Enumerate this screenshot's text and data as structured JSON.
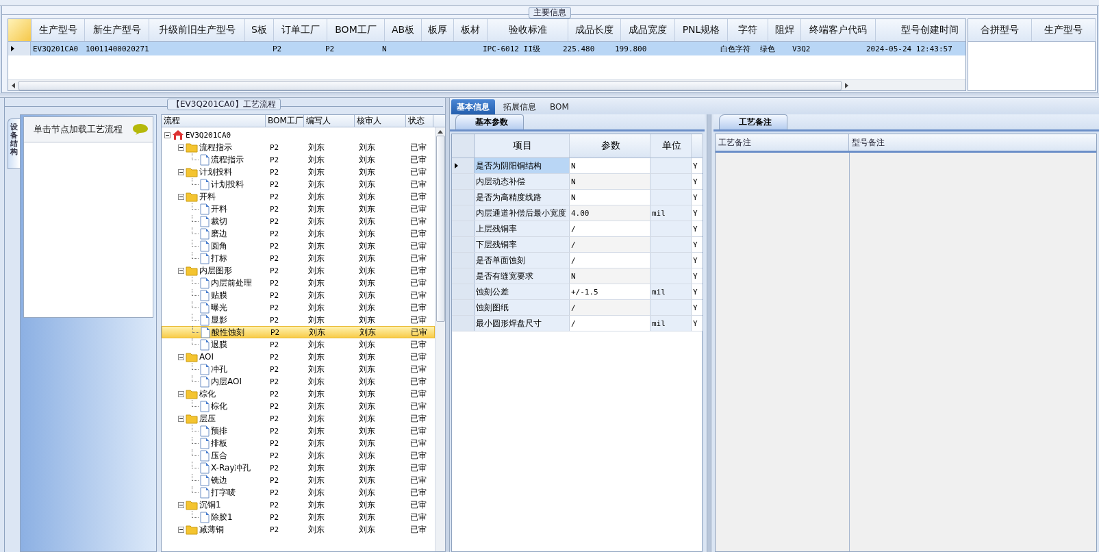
{
  "main_info": {
    "title": "主要信息",
    "columns": [
      "生产型号",
      "新生产型号",
      "升级前旧生产型号",
      "S板",
      "订单工厂",
      "BOM工厂",
      "AB板",
      "板厚",
      "板材",
      "验收标准",
      "成品长度",
      "成品宽度",
      "PNL规格",
      "字符",
      "阻焊",
      "终端客户代码",
      "型号创建时间"
    ],
    "rows": [
      {
        "selected": true,
        "cells": [
          "EV3Q201CA0",
          "10011400020271",
          "",
          "",
          "P2",
          "P2",
          "N",
          "",
          "",
          "IPC-6012 II级",
          "225.480",
          "199.800",
          "",
          "白色字符",
          "绿色",
          "V3Q2",
          "2024-05-24 12:43:57"
        ]
      }
    ],
    "side_columns": [
      "合拼型号",
      "生产型号"
    ]
  },
  "process": {
    "title": "【EV3Q201CA0】工艺流程",
    "side_tab": "设备结构",
    "hint": "单击节点加载工艺流程",
    "columns": [
      "流程",
      "BOM工厂",
      "编写人",
      "核审人",
      "状态"
    ],
    "tree": [
      {
        "kind": "root",
        "name": "EV3Q201CA0",
        "expanded": true,
        "selected": false,
        "children": [
          {
            "kind": "folder",
            "name": "流程指示",
            "bom": "P2",
            "writer": "刘东",
            "reviewer": "刘东",
            "status": "已审",
            "expanded": true,
            "selected": false,
            "children": [
              {
                "kind": "file",
                "name": "流程指示",
                "bom": "P2",
                "writer": "刘东",
                "reviewer": "刘东",
                "status": "已审",
                "selected": false
              }
            ]
          },
          {
            "kind": "folder",
            "name": "计划投料",
            "bom": "P2",
            "writer": "刘东",
            "reviewer": "刘东",
            "status": "已审",
            "expanded": true,
            "selected": false,
            "children": [
              {
                "kind": "file",
                "name": "计划投料",
                "bom": "P2",
                "writer": "刘东",
                "reviewer": "刘东",
                "status": "已审",
                "selected": false
              }
            ]
          },
          {
            "kind": "folder",
            "name": "开料",
            "bom": "P2",
            "writer": "刘东",
            "reviewer": "刘东",
            "status": "已审",
            "expanded": true,
            "selected": false,
            "children": [
              {
                "kind": "file",
                "name": "开料",
                "bom": "P2",
                "writer": "刘东",
                "reviewer": "刘东",
                "status": "已审",
                "selected": false
              },
              {
                "kind": "file",
                "name": "裁切",
                "bom": "P2",
                "writer": "刘东",
                "reviewer": "刘东",
                "status": "已审",
                "selected": false
              },
              {
                "kind": "file",
                "name": "磨边",
                "bom": "P2",
                "writer": "刘东",
                "reviewer": "刘东",
                "status": "已审",
                "selected": false
              },
              {
                "kind": "file",
                "name": "圆角",
                "bom": "P2",
                "writer": "刘东",
                "reviewer": "刘东",
                "status": "已审",
                "selected": false
              },
              {
                "kind": "file",
                "name": "打标",
                "bom": "P2",
                "writer": "刘东",
                "reviewer": "刘东",
                "status": "已审",
                "selected": false
              }
            ]
          },
          {
            "kind": "folder",
            "name": "内层图形",
            "bom": "P2",
            "writer": "刘东",
            "reviewer": "刘东",
            "status": "已审",
            "expanded": true,
            "selected": false,
            "children": [
              {
                "kind": "file",
                "name": "内层前处理",
                "bom": "P2",
                "writer": "刘东",
                "reviewer": "刘东",
                "status": "已审",
                "selected": false
              },
              {
                "kind": "file",
                "name": "贴膜",
                "bom": "P2",
                "writer": "刘东",
                "reviewer": "刘东",
                "status": "已审",
                "selected": false
              },
              {
                "kind": "file",
                "name": "曝光",
                "bom": "P2",
                "writer": "刘东",
                "reviewer": "刘东",
                "status": "已审",
                "selected": false
              },
              {
                "kind": "file",
                "name": "显影",
                "bom": "P2",
                "writer": "刘东",
                "reviewer": "刘东",
                "status": "已审",
                "selected": false
              },
              {
                "kind": "file",
                "name": "酸性蚀刻",
                "bom": "P2",
                "writer": "刘东",
                "reviewer": "刘东",
                "status": "已审",
                "selected": true
              },
              {
                "kind": "file",
                "name": "退膜",
                "bom": "P2",
                "writer": "刘东",
                "reviewer": "刘东",
                "status": "已审",
                "selected": false
              }
            ]
          },
          {
            "kind": "folder",
            "name": "AOI",
            "bom": "P2",
            "writer": "刘东",
            "reviewer": "刘东",
            "status": "已审",
            "expanded": true,
            "selected": false,
            "children": [
              {
                "kind": "file",
                "name": "冲孔",
                "bom": "P2",
                "writer": "刘东",
                "reviewer": "刘东",
                "status": "已审",
                "selected": false
              },
              {
                "kind": "file",
                "name": "内层AOI",
                "bom": "P2",
                "writer": "刘东",
                "reviewer": "刘东",
                "status": "已审",
                "selected": false
              }
            ]
          },
          {
            "kind": "folder",
            "name": "棕化",
            "bom": "P2",
            "writer": "刘东",
            "reviewer": "刘东",
            "status": "已审",
            "expanded": true,
            "selected": false,
            "children": [
              {
                "kind": "file",
                "name": "棕化",
                "bom": "P2",
                "writer": "刘东",
                "reviewer": "刘东",
                "status": "已审",
                "selected": false
              }
            ]
          },
          {
            "kind": "folder",
            "name": "层压",
            "bom": "P2",
            "writer": "刘东",
            "reviewer": "刘东",
            "status": "已审",
            "expanded": true,
            "selected": false,
            "children": [
              {
                "kind": "file",
                "name": "预排",
                "bom": "P2",
                "writer": "刘东",
                "reviewer": "刘东",
                "status": "已审",
                "selected": false
              },
              {
                "kind": "file",
                "name": "排板",
                "bom": "P2",
                "writer": "刘东",
                "reviewer": "刘东",
                "status": "已审",
                "selected": false
              },
              {
                "kind": "file",
                "name": "压合",
                "bom": "P2",
                "writer": "刘东",
                "reviewer": "刘东",
                "status": "已审",
                "selected": false
              },
              {
                "kind": "file",
                "name": "X-Ray冲孔",
                "bom": "P2",
                "writer": "刘东",
                "reviewer": "刘东",
                "status": "已审",
                "selected": false
              },
              {
                "kind": "file",
                "name": "铣边",
                "bom": "P2",
                "writer": "刘东",
                "reviewer": "刘东",
                "status": "已审",
                "selected": false
              },
              {
                "kind": "file",
                "name": "打字唛",
                "bom": "P2",
                "writer": "刘东",
                "reviewer": "刘东",
                "status": "已审",
                "selected": false
              }
            ]
          },
          {
            "kind": "folder",
            "name": "沉铜1",
            "bom": "P2",
            "writer": "刘东",
            "reviewer": "刘东",
            "status": "已审",
            "expanded": true,
            "selected": false,
            "children": [
              {
                "kind": "file",
                "name": "除胶1",
                "bom": "P2",
                "writer": "刘东",
                "reviewer": "刘东",
                "status": "已审",
                "selected": false
              }
            ]
          },
          {
            "kind": "folder",
            "name": "减薄铜",
            "bom": "P2",
            "writer": "刘东",
            "reviewer": "刘东",
            "status": "已审",
            "expanded": true,
            "selected": false
          }
        ]
      }
    ]
  },
  "tabs": [
    {
      "label": "基本信息",
      "selected": true
    },
    {
      "label": "拓展信息",
      "selected": false
    },
    {
      "label": "BOM",
      "selected": false
    }
  ],
  "basic_params": {
    "title": "基本参数",
    "columns": [
      "项目",
      "参数",
      "单位"
    ],
    "rows": [
      {
        "item": "是否为阴阳铜结构",
        "value": "N",
        "unit": "",
        "column_4": "Y",
        "selected": true
      },
      {
        "item": "内层动态补偿",
        "value": "N",
        "unit": "",
        "column_4": "Y",
        "selected": false
      },
      {
        "item": "是否为高精度线路",
        "value": "N",
        "unit": "",
        "column_4": "Y",
        "selected": false
      },
      {
        "item": "内层通道补偿后最小宽度",
        "value": "4.00",
        "unit": "mil",
        "column_4": "Y",
        "selected": false
      },
      {
        "item": "上层残铜率",
        "value": "/",
        "unit": "",
        "column_4": "Y",
        "selected": false
      },
      {
        "item": "下层残铜率",
        "value": "/",
        "unit": "",
        "column_4": "Y",
        "selected": false
      },
      {
        "item": "是否单面蚀刻",
        "value": "/",
        "unit": "",
        "column_4": "Y",
        "selected": false
      },
      {
        "item": "是否有缝宽要求",
        "value": "N",
        "unit": "",
        "column_4": "Y",
        "selected": false
      },
      {
        "item": "蚀刻公差",
        "value": "+/-1.5",
        "unit": "mil",
        "column_4": "Y",
        "selected": false
      },
      {
        "item": "蚀刻图纸",
        "value": "/",
        "unit": "",
        "column_4": "Y",
        "selected": false
      },
      {
        "item": "最小圆形焊盘尺寸",
        "value": "/",
        "unit": "mil",
        "column_4": "Y",
        "selected": false
      }
    ]
  },
  "process_notes": {
    "title": "工艺备注",
    "columns": [
      "工艺备注",
      "型号备注"
    ]
  }
}
